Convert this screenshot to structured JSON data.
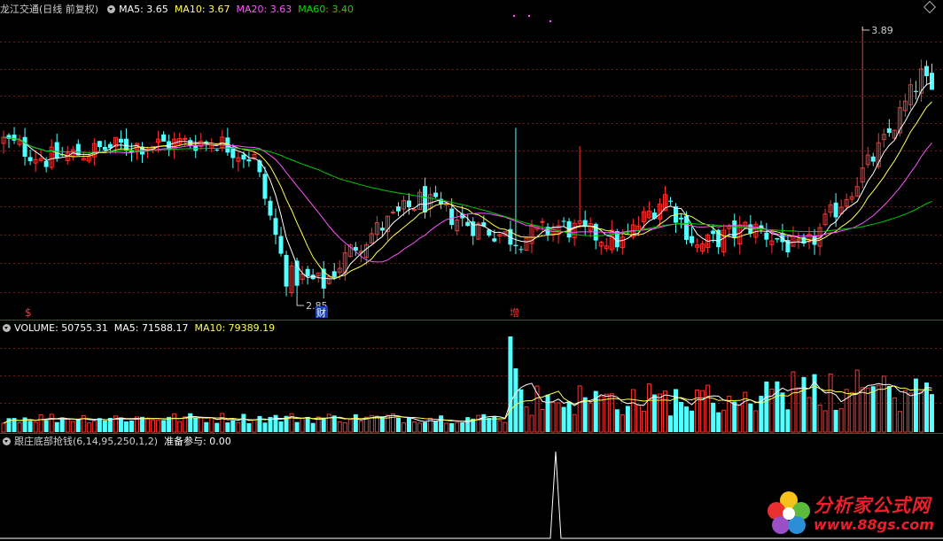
{
  "header": {
    "stock": "龙江交通(日线 前复权)",
    "ma5": "MA5: 3.65",
    "ma10": "MA10: 3.67",
    "ma20": "MA20: 3.63",
    "ma60": "MA60: 3.40"
  },
  "volume_header": {
    "volume": "VOLUME: 50755.31",
    "ma5": "MA5: 71588.17",
    "ma10": "MA10: 79389.19"
  },
  "indicator_header": {
    "name": "跟庄底部抢钱(6,14,95,250,1,2)",
    "value": "准备参与: 0.00"
  },
  "markers": {
    "low_label": "2.85",
    "high_label": "3.89",
    "tag_left": "$",
    "tag_cai": "财",
    "tag_zeng": "增"
  },
  "watermark": {
    "name": "分析家公式网",
    "url": "www.88gs.com"
  },
  "colors": {
    "up": "#ff3232",
    "down": "#54ffff",
    "ma5": "#ffffff",
    "ma10": "#ffff54",
    "ma20": "#ff54ff",
    "ma60": "#00c800",
    "grid": "#781a1a"
  },
  "chart_data": [
    {
      "type": "candlestick",
      "ylim": [
        2.75,
        3.97
      ],
      "low": 2.85,
      "high": 3.89,
      "bars": 175,
      "ma_series": [
        {
          "name": "MA5",
          "last": 3.65
        },
        {
          "name": "MA10",
          "last": 3.67
        },
        {
          "name": "MA20",
          "last": 3.63
        },
        {
          "name": "MA60",
          "last": 3.4
        }
      ]
    },
    {
      "type": "bar",
      "series": [
        {
          "name": "VOLUME",
          "last": 50755.31
        },
        {
          "name": "MA5",
          "last": 71588.17
        },
        {
          "name": "MA10",
          "last": 79389.19
        }
      ]
    },
    {
      "type": "line",
      "series": [
        {
          "name": "准备参与",
          "last": 0.0
        }
      ]
    }
  ]
}
